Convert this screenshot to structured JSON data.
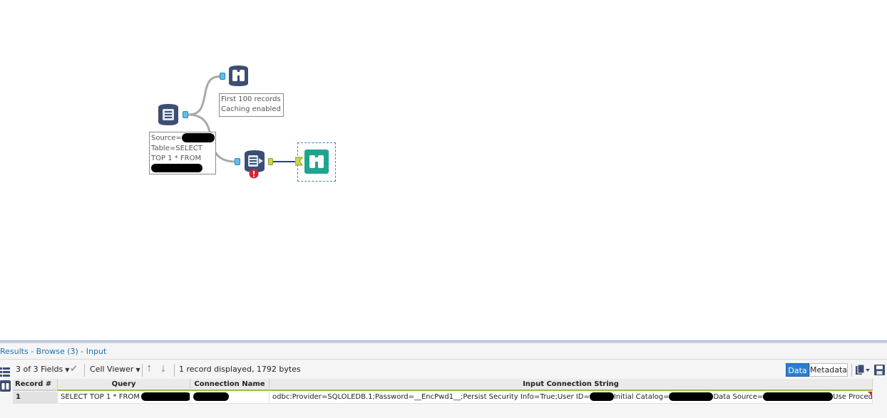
{
  "canvas": {
    "annotation_browse1": {
      "line1": "First 100 records",
      "line2": "Caching enabled"
    },
    "annotation_input": {
      "line1": "Source=",
      "line2": "Table=SELECT",
      "line3": "TOP 1 * FROM"
    },
    "icons": {
      "input_tool": "database-input-icon",
      "browse_tool_1": "binoculars-icon",
      "dynamic_input_tool": "dynamic-input-icon",
      "error_badge": "error-icon",
      "browse_tool_2": "binoculars-icon"
    },
    "colors": {
      "tool_dark": "#3c4e73",
      "browse_green": "#1fa58f",
      "anchor_blue": "#5bc0eb",
      "anchor_green": "#c9d84a",
      "error_red": "#d9232d",
      "wire_gray": "#a9a9a9",
      "wire_blue": "#2f3a9a"
    }
  },
  "results": {
    "title": "Results - Browse (3) - Input",
    "toolbar": {
      "fields": "3 of 3 Fields",
      "cell_viewer": "Cell Viewer",
      "status": "1 record displayed, 1792 bytes",
      "data_button": "Data",
      "metadata_button": "Metadata"
    },
    "table": {
      "columns": [
        "Record #",
        "Query",
        "Connection Name",
        "Input Connection String"
      ],
      "rows": [
        {
          "record": "1",
          "query": "SELECT TOP 1 * FROM",
          "connection_name": "",
          "conn_parts": [
            "odbc:Provider=SQLOLEDB.1;Password=__EncPwd1__;Persist Security Info=True;User ID=",
            "Initial Catalog=",
            "Data Source=",
            "Use Procedure for Prepar..."
          ]
        }
      ]
    }
  }
}
